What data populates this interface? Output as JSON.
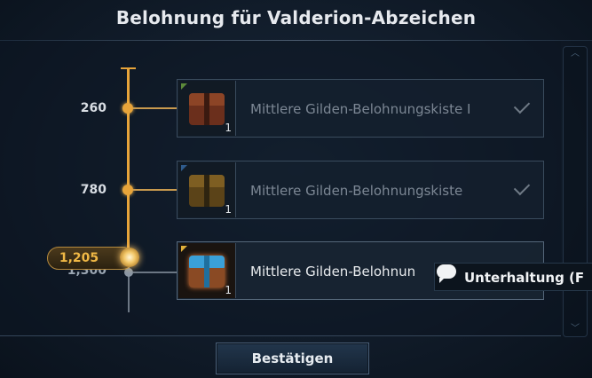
{
  "title": "Belohnung für Valderion-Abzeichen",
  "progress": {
    "current_label": "1,205"
  },
  "tiers": [
    {
      "threshold": "260",
      "reward_label": "Mittlere Gilden-Belohnungskiste I",
      "quantity": "1",
      "claimed": true
    },
    {
      "threshold": "780",
      "reward_label": "Mittlere Gilden-Belohnungskiste",
      "quantity": "1",
      "claimed": true
    },
    {
      "threshold": "1,300",
      "reward_label": "Mittlere Gilden-Belohnun",
      "quantity": "1",
      "claimed": false
    }
  ],
  "tooltip": {
    "text": "Unterhaltung (F",
    "icon": "chat-bubble-icon"
  },
  "confirm_button": {
    "label": "Bestätigen"
  },
  "colors": {
    "track_gold": "#e7a43a",
    "badge_text": "#f0b845"
  }
}
